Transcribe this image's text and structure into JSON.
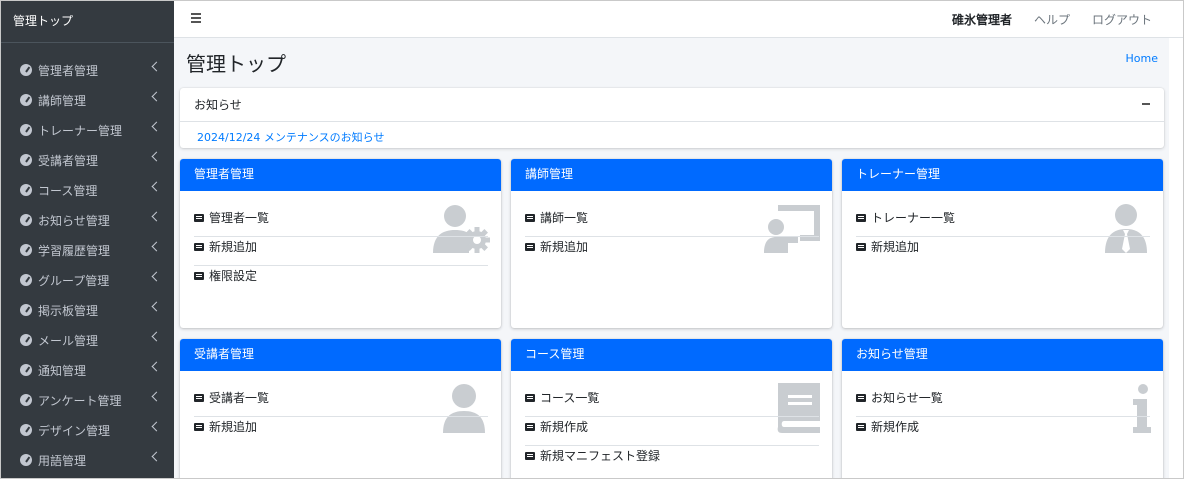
{
  "brand": "管理トップ",
  "sidebar": {
    "items": [
      {
        "label": "管理者管理"
      },
      {
        "label": "講師管理"
      },
      {
        "label": "トレーナー管理"
      },
      {
        "label": "受講者管理"
      },
      {
        "label": "コース管理"
      },
      {
        "label": "お知らせ管理"
      },
      {
        "label": "学習履歴管理"
      },
      {
        "label": "グループ管理"
      },
      {
        "label": "掲示板管理"
      },
      {
        "label": "メール管理"
      },
      {
        "label": "通知管理"
      },
      {
        "label": "アンケート管理"
      },
      {
        "label": "デザイン管理"
      },
      {
        "label": "用語管理"
      }
    ]
  },
  "topbar": {
    "user": "碓氷管理者",
    "help": "ヘルプ",
    "logout": "ログアウト"
  },
  "page": {
    "title": "管理トップ",
    "breadcrumb": "Home"
  },
  "notice": {
    "title": "お知らせ",
    "link": "2024/12/24 メンテナンスのお知らせ"
  },
  "cards": [
    {
      "title": "管理者管理",
      "icon": "user-gear-icon",
      "items": [
        "管理者一覧",
        "新規追加",
        "権限設定"
      ]
    },
    {
      "title": "講師管理",
      "icon": "teacher-board-icon",
      "items": [
        "講師一覧",
        "新規追加"
      ]
    },
    {
      "title": "トレーナー管理",
      "icon": "user-tie-icon",
      "items": [
        "トレーナー一覧",
        "新規追加"
      ]
    },
    {
      "title": "受講者管理",
      "icon": "user-icon",
      "items": [
        "受講者一覧",
        "新規追加"
      ]
    },
    {
      "title": "コース管理",
      "icon": "book-icon",
      "items": [
        "コース一覧",
        "新規作成",
        "新規マニフェスト登録"
      ]
    },
    {
      "title": "お知らせ管理",
      "icon": "info-icon",
      "items": [
        "お知らせ一覧",
        "新規作成"
      ]
    }
  ],
  "colors": {
    "sidebar_bg": "#343a40",
    "card_header": "#006aff",
    "link": "#007bff",
    "content_bg": "#f4f6f9"
  }
}
